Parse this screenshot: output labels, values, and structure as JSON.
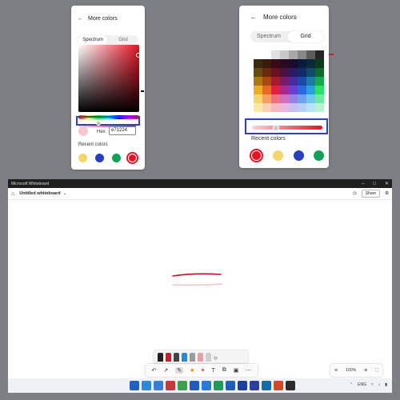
{
  "left_panel": {
    "title": "More colors",
    "tabs": [
      "Spectrum",
      "Grid"
    ],
    "active_tab": "Spectrum",
    "hex_label": "Hex",
    "hex_value": "e71224",
    "recent_label": "Recent colors",
    "recent_colors": [
      "#f5d66a",
      "#2a3fbf",
      "#13a05a",
      "#e71224"
    ]
  },
  "right_panel": {
    "title": "More colors",
    "tabs": [
      "Spectrum",
      "Grid"
    ],
    "active_tab": "Grid",
    "recent_label": "Recent colors",
    "recent_colors": [
      "#e71224",
      "#f5d66a",
      "#2a3fbf",
      "#13a05a"
    ],
    "grid_colors": [
      "#ffffff",
      "#ffffff",
      "#e0e0e0",
      "#c8c8c8",
      "#a8a8a8",
      "#888888",
      "#5c5c5c",
      "#262626",
      "#3a2a10",
      "#3a1a0a",
      "#3a0a14",
      "#2a0a22",
      "#1a0a30",
      "#0a1a3a",
      "#0a2a3a",
      "#0a3a1a",
      "#6a4a10",
      "#6a2a10",
      "#6a1020",
      "#4a1040",
      "#2a1a60",
      "#102a6a",
      "#104a6a",
      "#106a2a",
      "#a87a10",
      "#a84a10",
      "#a81a30",
      "#7a1a6a",
      "#4a2aa0",
      "#1a4aa8",
      "#1a7aa8",
      "#1aa84a",
      "#e8b020",
      "#e86a20",
      "#e02040",
      "#a82a90",
      "#6a40d0",
      "#2a6ae0",
      "#2aa0e0",
      "#2ae06a",
      "#f5d66a",
      "#f5a060",
      "#f07080",
      "#d070c0",
      "#9a80e0",
      "#70a0f0",
      "#70c8f0",
      "#70e8a0",
      "#fae8a8",
      "#fad0b0",
      "#f8b8c0",
      "#e8b8e0",
      "#c8c0f0",
      "#b8d0f8",
      "#b8e4f8",
      "#b8f4d0"
    ]
  },
  "app": {
    "window_title": "Microsoft Whiteboard",
    "board_title": "Untitled whiteboard",
    "share_label": "Share",
    "zoom_level": "100%",
    "stroke_colors": [
      "#c0101c",
      "#f4c4cb"
    ]
  },
  "pens": [
    "#222222",
    "#d01b2c",
    "#444444",
    "#2a88d6",
    "#9b9b9b",
    "#e8a0a6",
    "#cfcfcf"
  ],
  "taskbar": {
    "language": "ENG",
    "icons": [
      "#1e62c4",
      "#2a8bd6",
      "#3a7bd5",
      "#c43a3a",
      "#3aa04a",
      "#1a5dbf",
      "#2b7bd6",
      "#1f9b5a",
      "#1e5fb8",
      "#1e3f9a",
      "#2b3da3",
      "#126eaa",
      "#d04a2a",
      "#2c2c2c"
    ]
  }
}
